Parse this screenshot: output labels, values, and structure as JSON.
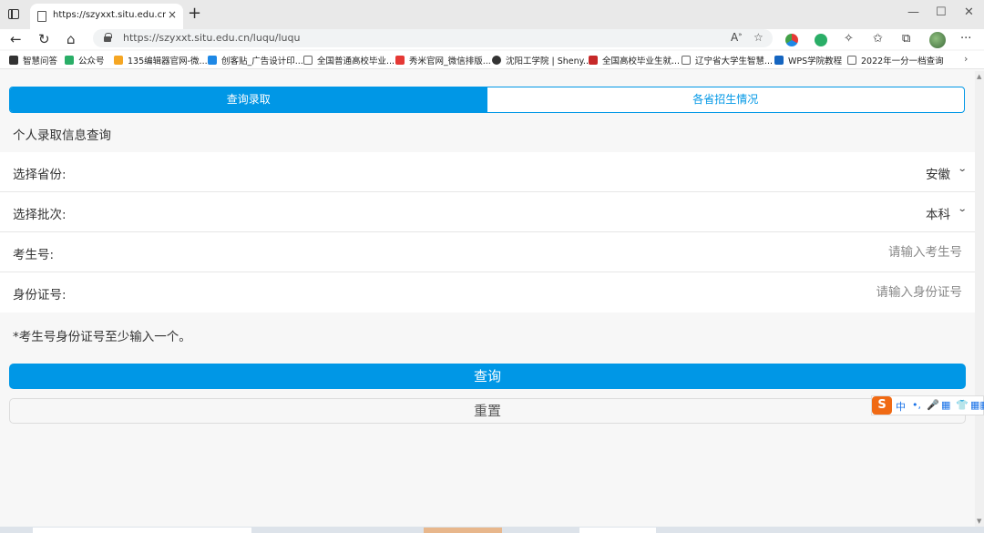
{
  "browser": {
    "tab_title": "https://szyxxt.situ.edu.cn/luqu/lu",
    "tab_close": "×",
    "new_tab": "+",
    "url": "https://szyxxt.situ.edu.cn/luqu/luqu",
    "window_controls": [
      "—",
      "☐",
      "✕"
    ],
    "more_menu": "···"
  },
  "bookmarks": [
    {
      "label": "智慧问答",
      "color": "#333333"
    },
    {
      "label": "公众号",
      "color": "#2aae67"
    },
    {
      "label": "135编辑器官网-微...",
      "color": "#f5a623"
    },
    {
      "label": "创客贴_广告设计印...",
      "color": "#1e88e5"
    },
    {
      "label": "全国普通高校毕业...",
      "color": "#666666"
    },
    {
      "label": "秀米官网_微信排版...",
      "color": "#e53935"
    },
    {
      "label": "沈阳工学院 | Sheny...",
      "color": "#333333"
    },
    {
      "label": "全国高校毕业生就...",
      "color": "#c62828"
    },
    {
      "label": "辽宁省大学生智慧...",
      "color": "#666666"
    },
    {
      "label": "WPS学院教程",
      "color": "#1565c0"
    },
    {
      "label": "2022年一分一档查询",
      "color": "#666666"
    }
  ],
  "page": {
    "tabs": [
      {
        "label": "查询录取",
        "active": true
      },
      {
        "label": "各省招生情况",
        "active": false
      }
    ],
    "section_title": "个人录取信息查询",
    "form": {
      "province_label": "选择省份:",
      "province_value": "安徽",
      "batch_label": "选择批次:",
      "batch_value": "本科",
      "exam_no_label": "考生号:",
      "exam_no_placeholder": "请输入考生号",
      "id_label": "身份证号:",
      "id_placeholder": "请输入身份证号"
    },
    "note": "*考生号身份证号至少输入一个。",
    "query_button": "查询",
    "reset_button": "重置"
  },
  "ime": {
    "logo": "S",
    "items": [
      "中",
      "•,",
      "🎤",
      "▦",
      "👕",
      "▦▦"
    ]
  },
  "colors": {
    "primary": "#0097e6",
    "background": "#f7f7f7",
    "ime_orange": "#f06a14"
  }
}
